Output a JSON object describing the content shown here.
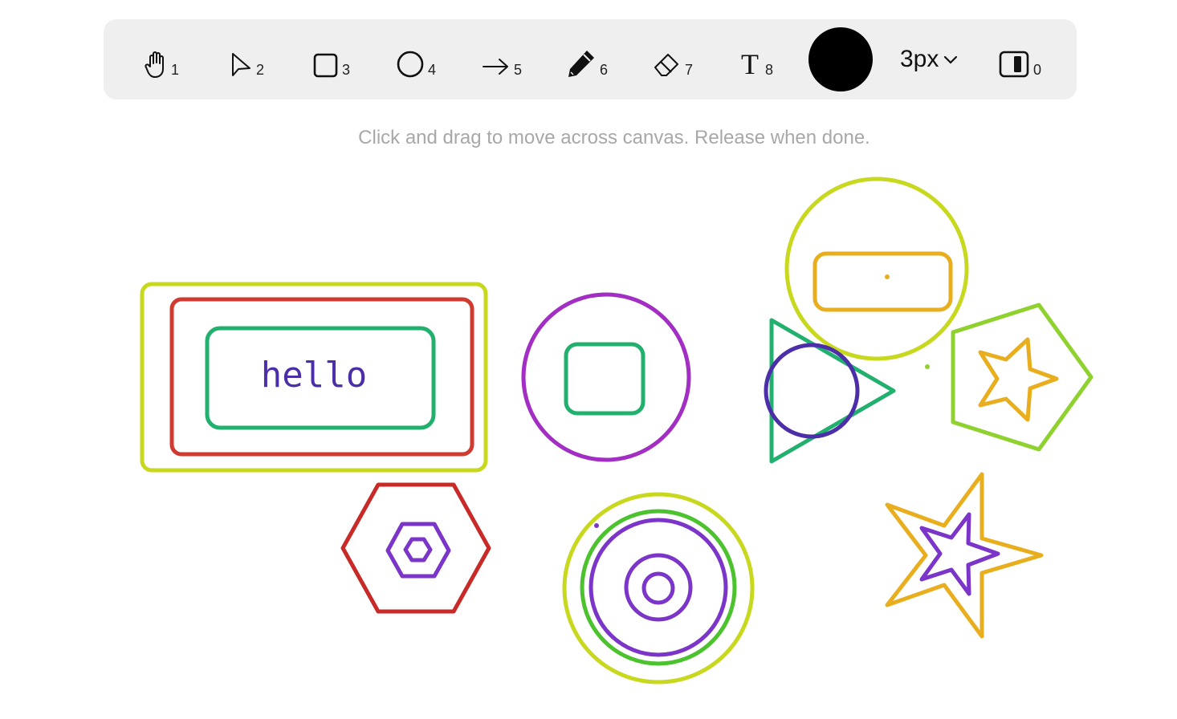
{
  "toolbar": {
    "tools": [
      {
        "icon": "hand-icon",
        "key": "1"
      },
      {
        "icon": "pointer-icon",
        "key": "2"
      },
      {
        "icon": "rectangle-icon",
        "key": "3"
      },
      {
        "icon": "circle-icon",
        "key": "4"
      },
      {
        "icon": "arrow-icon",
        "key": "5"
      },
      {
        "icon": "pencil-icon",
        "key": "6"
      },
      {
        "icon": "eraser-icon",
        "key": "7"
      },
      {
        "icon": "text-icon",
        "glyph": "T",
        "key": "8"
      }
    ],
    "color": "#000000",
    "stroke_width": "3px",
    "panel_toggle": {
      "icon": "panel-toggle-icon",
      "key": "0"
    }
  },
  "hint": "Click and drag to move across canvas. Release when done.",
  "canvas": {
    "text_label": "hello",
    "colors": {
      "lime": "#c8d81e",
      "red": "#d13a30",
      "green": "#22b06e",
      "purple": "#a32ec4",
      "violet": "#7b35c8",
      "indigo": "#4b2ea8",
      "orange": "#e8ae1e",
      "yellowgreen": "#8fd12e",
      "brightgreen": "#4cc22e",
      "darkred": "#c82a28"
    }
  }
}
